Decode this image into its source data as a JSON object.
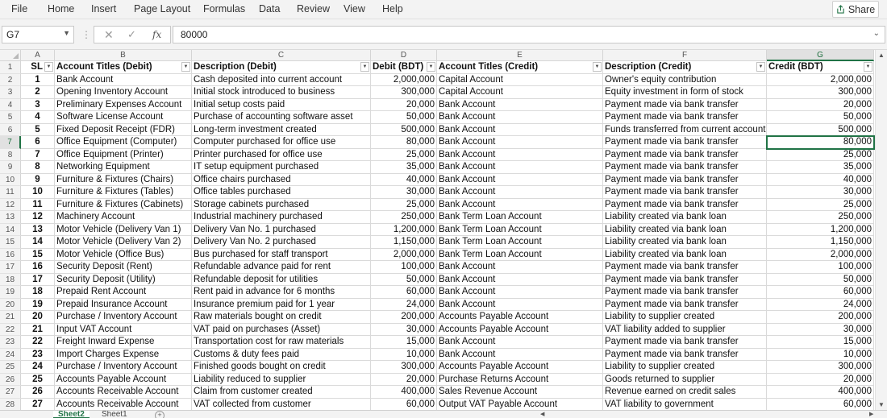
{
  "menu": [
    "File",
    "Home",
    "Insert",
    "Page Layout",
    "Formulas",
    "Data",
    "Review",
    "View",
    "Help"
  ],
  "share_label": "Share",
  "name_box": "G7",
  "formula_value": "80000",
  "columns": [
    "A",
    "B",
    "C",
    "D",
    "E",
    "F",
    "G"
  ],
  "active_cell": {
    "row": 7,
    "col": "G"
  },
  "headers": [
    "SL",
    "Account Titles (Debit)",
    "Description (Debit)",
    "Debit (BDT)",
    "Account Titles (Credit)",
    "Description (Credit)",
    "Credit (BDT)"
  ],
  "rows": [
    [
      "1",
      "Bank Account",
      "Cash deposited into current account",
      "2,000,000",
      "Capital Account",
      "Owner's equity contribution",
      "2,000,000"
    ],
    [
      "2",
      "Opening Inventory Account",
      "Initial stock introduced to business",
      "300,000",
      "Capital Account",
      "Equity investment in form of stock",
      "300,000"
    ],
    [
      "3",
      "Preliminary Expenses Account",
      "Initial setup costs paid",
      "20,000",
      "Bank Account",
      "Payment made via bank transfer",
      "20,000"
    ],
    [
      "4",
      "Software License Account",
      "Purchase of accounting software asset",
      "50,000",
      "Bank Account",
      "Payment made via bank transfer",
      "50,000"
    ],
    [
      "5",
      "Fixed Deposit Receipt (FDR)",
      "Long-term investment created",
      "500,000",
      "Bank Account",
      "Funds transferred from current account",
      "500,000"
    ],
    [
      "6",
      "Office Equipment (Computer)",
      "Computer purchased for office use",
      "80,000",
      "Bank Account",
      "Payment made via bank transfer",
      "80,000"
    ],
    [
      "7",
      "Office Equipment (Printer)",
      "Printer purchased for office use",
      "25,000",
      "Bank Account",
      "Payment made via bank transfer",
      "25,000"
    ],
    [
      "8",
      "Networking Equipment",
      "IT setup equipment purchased",
      "35,000",
      "Bank Account",
      "Payment made via bank transfer",
      "35,000"
    ],
    [
      "9",
      "Furniture & Fixtures (Chairs)",
      "Office chairs purchased",
      "40,000",
      "Bank Account",
      "Payment made via bank transfer",
      "40,000"
    ],
    [
      "10",
      "Furniture & Fixtures (Tables)",
      "Office tables purchased",
      "30,000",
      "Bank Account",
      "Payment made via bank transfer",
      "30,000"
    ],
    [
      "11",
      "Furniture & Fixtures (Cabinets)",
      "Storage cabinets purchased",
      "25,000",
      "Bank Account",
      "Payment made via bank transfer",
      "25,000"
    ],
    [
      "12",
      "Machinery Account",
      "Industrial machinery purchased",
      "250,000",
      "Bank Term Loan Account",
      "Liability created via bank loan",
      "250,000"
    ],
    [
      "13",
      "Motor Vehicle (Delivery Van 1)",
      "Delivery Van No. 1 purchased",
      "1,200,000",
      "Bank Term Loan Account",
      "Liability created via bank loan",
      "1,200,000"
    ],
    [
      "14",
      "Motor Vehicle (Delivery Van 2)",
      "Delivery Van No. 2 purchased",
      "1,150,000",
      "Bank Term Loan Account",
      "Liability created via bank loan",
      "1,150,000"
    ],
    [
      "15",
      "Motor Vehicle (Office Bus)",
      "Bus purchased for staff transport",
      "2,000,000",
      "Bank Term Loan Account",
      "Liability created via bank loan",
      "2,000,000"
    ],
    [
      "16",
      "Security Deposit (Rent)",
      "Refundable advance paid for rent",
      "100,000",
      "Bank Account",
      "Payment made via bank transfer",
      "100,000"
    ],
    [
      "17",
      "Security Deposit (Utility)",
      "Refundable deposit for utilities",
      "50,000",
      "Bank Account",
      "Payment made via bank transfer",
      "50,000"
    ],
    [
      "18",
      "Prepaid Rent Account",
      "Rent paid in advance for 6 months",
      "60,000",
      "Bank Account",
      "Payment made via bank transfer",
      "60,000"
    ],
    [
      "19",
      "Prepaid Insurance Account",
      "Insurance premium paid for 1 year",
      "24,000",
      "Bank Account",
      "Payment made via bank transfer",
      "24,000"
    ],
    [
      "20",
      "Purchase / Inventory Account",
      "Raw materials bought on credit",
      "200,000",
      "Accounts Payable Account",
      "Liability to supplier created",
      "200,000"
    ],
    [
      "21",
      "Input VAT Account",
      "VAT paid on purchases (Asset)",
      "30,000",
      "Accounts Payable Account",
      "VAT liability added to supplier",
      "30,000"
    ],
    [
      "22",
      "Freight Inward Expense",
      "Transportation cost for raw materials",
      "15,000",
      "Bank Account",
      "Payment made via bank transfer",
      "15,000"
    ],
    [
      "23",
      "Import Charges Expense",
      "Customs & duty fees paid",
      "10,000",
      "Bank Account",
      "Payment made via bank transfer",
      "10,000"
    ],
    [
      "24",
      "Purchase / Inventory Account",
      "Finished goods bought on credit",
      "300,000",
      "Accounts Payable Account",
      "Liability to supplier created",
      "300,000"
    ],
    [
      "25",
      "Accounts Payable Account",
      "Liability reduced to supplier",
      "20,000",
      "Purchase Returns Account",
      "Goods returned to supplier",
      "20,000"
    ],
    [
      "26",
      "Accounts Receivable Account",
      "Claim from customer created",
      "400,000",
      "Sales Revenue Account",
      "Revenue earned on credit sales",
      "400,000"
    ],
    [
      "27",
      "Accounts Receivable Account",
      "VAT collected from customer",
      "60,000",
      "Output VAT Payable Account",
      "VAT liability to government",
      "60,000"
    ]
  ],
  "sheets": [
    "Sheet2",
    "Sheet1"
  ],
  "active_sheet": "Sheet2"
}
